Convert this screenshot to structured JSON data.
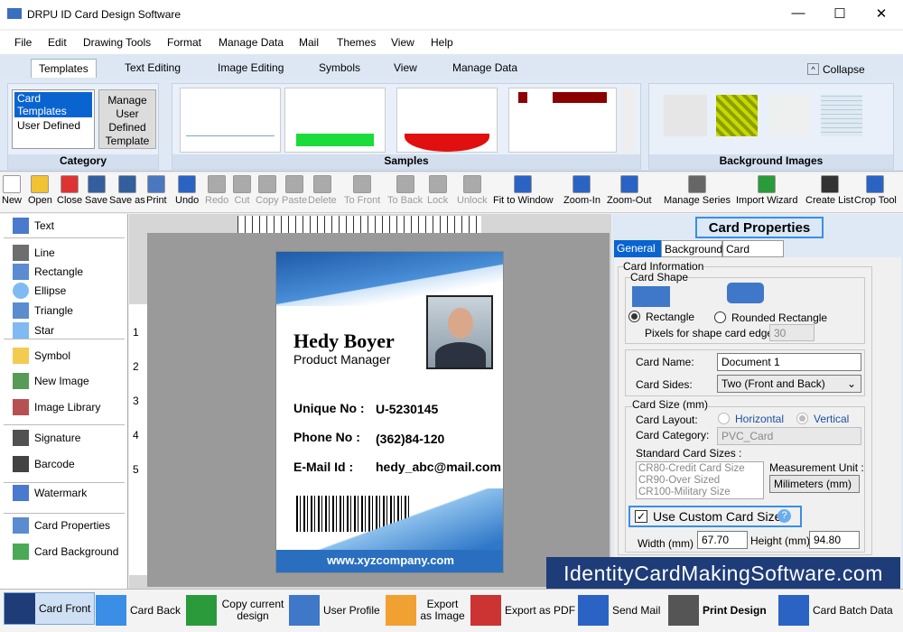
{
  "window": {
    "title": "DRPU ID Card Design Software",
    "minimize": "—",
    "maximize": "☐",
    "close": "✕"
  },
  "menu": [
    "File",
    "Edit",
    "Drawing Tools",
    "Format",
    "Manage Data",
    "Mail",
    "Themes",
    "View",
    "Help"
  ],
  "ribbon_tabs": [
    "Templates",
    "Text Editing",
    "Image Editing",
    "Symbols",
    "View",
    "Manage Data"
  ],
  "collapse_label": "Collapse",
  "category": {
    "label": "Category",
    "items": [
      "Card Templates",
      "User Defined"
    ],
    "manage_button": "Manage User Defined Template"
  },
  "samples_label": "Samples",
  "background_label": "Background Images",
  "toolbar": [
    "New",
    "Open",
    "Close",
    "Save",
    "Save as",
    "Print",
    "Undo",
    "Redo",
    "Cut",
    "Copy",
    "Paste",
    "Delete",
    "To Front",
    "To Back",
    "Lock",
    "Unlock",
    "Fit to Window",
    "Zoom-In",
    "Zoom-Out",
    "Manage Series",
    "Import Wizard",
    "Create List",
    "Crop Tool"
  ],
  "left_tools": [
    "Text",
    "Line",
    "Rectangle",
    "Ellipse",
    "Triangle",
    "Star",
    "Symbol",
    "New Image",
    "Image Library",
    "Signature",
    "Barcode",
    "Watermark",
    "Card Properties",
    "Card Background"
  ],
  "ruler": {
    "left": [
      "1",
      "2",
      "3",
      "4",
      "5"
    ]
  },
  "card": {
    "name": "Hedy Boyer",
    "title": "Product Manager",
    "fields": [
      {
        "label": "Unique No :",
        "value": "U-5230145"
      },
      {
        "label": "Phone No :",
        "value": "(362)84-120"
      },
      {
        "label": "E-Mail Id :",
        "value": "hedy_abc@mail.com"
      }
    ],
    "website": "www.xyzcompany.com"
  },
  "props": {
    "header": "Card Properties",
    "tabs": [
      "General",
      "Background",
      "Card Border"
    ],
    "card_information": "Card Information",
    "card_shape": "Card Shape",
    "rectangle": "Rectangle",
    "rounded_rectangle": "Rounded Rectangle",
    "pixels_label": "Pixels for shape card edge :",
    "pixels_value": "30",
    "card_name_label": "Card Name:",
    "card_name_value": "Document 1",
    "card_sides_label": "Card Sides:",
    "card_sides_value": "Two (Front and Back)",
    "card_size": "Card Size (mm)",
    "card_layout_label": "Card Layout:",
    "horizontal": "Horizontal",
    "vertical": "Vertical",
    "card_category_label": "Card Category:",
    "card_category_value": "PVC_Card",
    "standard_sizes_label": "Standard Card Sizes :",
    "standard_sizes": [
      "CR80-Credit Card Size",
      "CR90-Over Sized",
      "CR100-Military Size"
    ],
    "measurement_label": "Measurement Unit :",
    "measurement_value": "Milimeters (mm)",
    "custom_size": "Use Custom Card Size",
    "custom_checked": true,
    "width_label": "Width  (mm)",
    "width_value": "67.70",
    "height_label": "Height  (mm)",
    "height_value": "94.80"
  },
  "watermark": "IdentityCardMakingSoftware.com",
  "bottom": [
    "Card Front",
    "Card Back",
    "Copy current design",
    "User Profile",
    "Export as Image",
    "Export as PDF",
    "Send Mail",
    "Print Design",
    "Card Batch Data"
  ]
}
